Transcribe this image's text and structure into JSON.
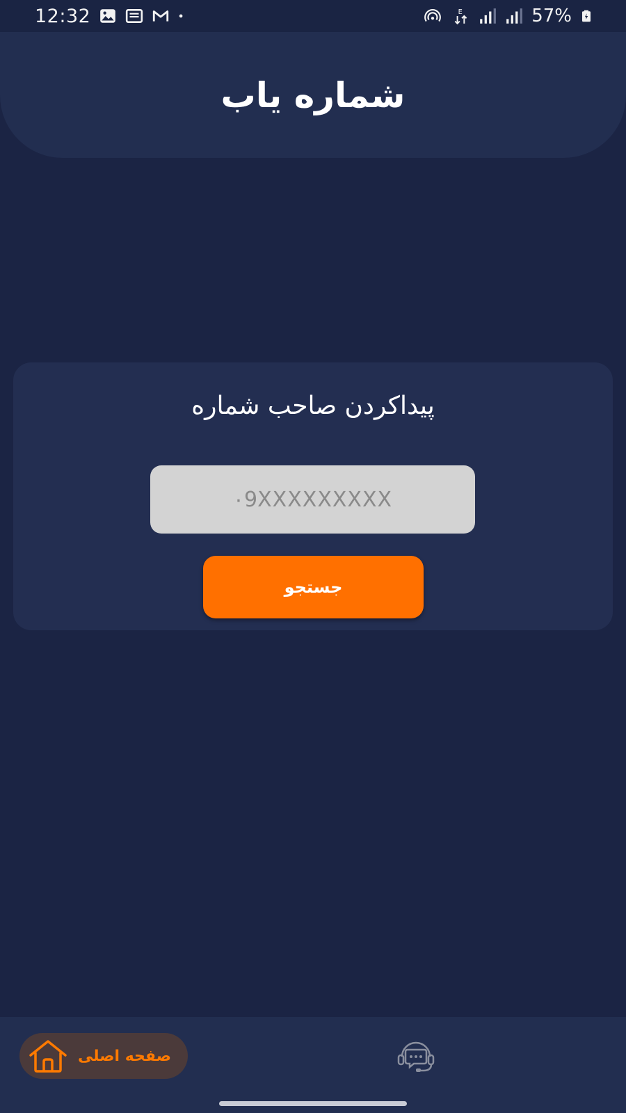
{
  "status_bar": {
    "time": "12:32",
    "battery": "57%",
    "left_icons": [
      "gallery-icon",
      "news-icon",
      "gmail-icon",
      "dot-icon"
    ],
    "right_icons": [
      "hotspot-icon",
      "data-arrows-icon",
      "signal-icon",
      "signal-icon",
      "battery-icon"
    ]
  },
  "header": {
    "title": "شماره یاب"
  },
  "search_card": {
    "title": "پیداکردن صاحب شماره",
    "input_placeholder": "۰9XXXXXXXXX",
    "button_label": "جستجو"
  },
  "bottom_nav": {
    "home_label": "صفحه اصلی",
    "home_icon": "home-icon",
    "support_icon": "support-chat-icon"
  },
  "colors": {
    "background": "#1b2444",
    "surface": "#222e50",
    "accent": "#ff7000",
    "input": "#d3d3d3"
  }
}
